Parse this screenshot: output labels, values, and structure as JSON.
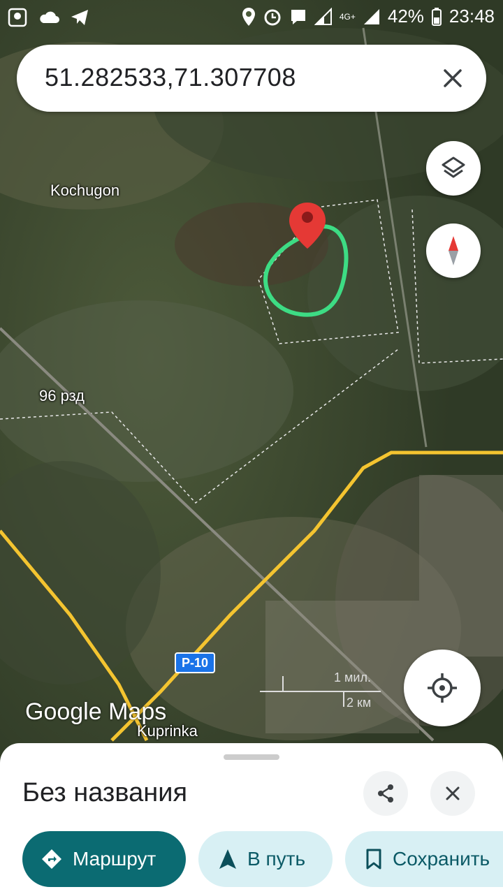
{
  "status_bar": {
    "battery": "42%",
    "time": "23:48",
    "network": "4G+"
  },
  "search": {
    "value": "51.282533,71.307708",
    "close_icon": "close-icon"
  },
  "map_labels": {
    "place1": "Kochugon",
    "place2": "96 рзд",
    "place3": "Kuprinka",
    "road": "P-10",
    "scale_top": "1 мил.",
    "scale_bottom": "2 км",
    "watermark": "Google Maps"
  },
  "controls": {
    "layers_icon": "layers-icon",
    "compass_icon": "compass-icon",
    "location_icon": "my-location-icon"
  },
  "sheet": {
    "title": "Без названия",
    "share_icon": "share-icon",
    "close_icon": "close-icon",
    "actions": [
      {
        "label": "Маршрут",
        "icon": "directions-icon"
      },
      {
        "label": "В путь",
        "icon": "navigation-icon"
      },
      {
        "label": "Сохранить",
        "icon": "bookmark-icon"
      }
    ]
  },
  "colors": {
    "accent": "#0b6b72",
    "secondary_bg": "#d8f0f4",
    "pin": "#e53935",
    "highlight": "#3ddc84"
  }
}
